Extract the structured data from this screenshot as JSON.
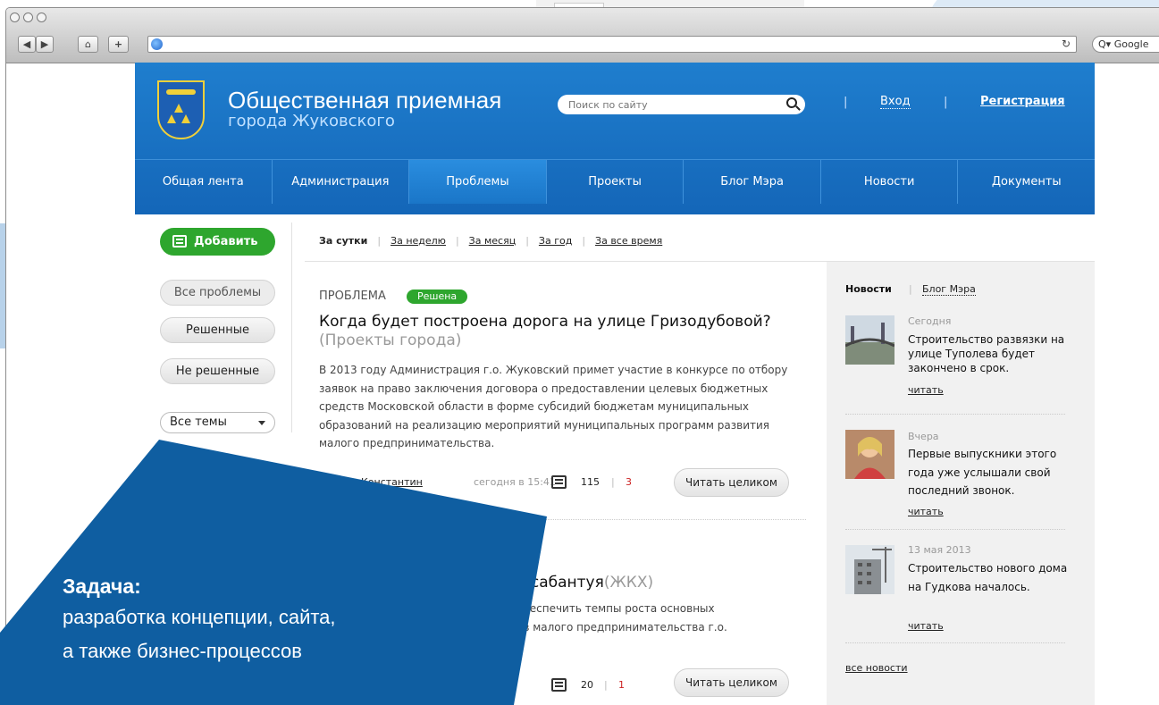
{
  "browser": {
    "search_placeholder": "Google"
  },
  "header": {
    "title": "Общественная приемная",
    "subtitle": "города Жуковского",
    "search_placeholder": "Поиск по сайту",
    "separator": "|",
    "login": "Вход",
    "register": "Регистрация"
  },
  "nav": [
    "Общая лента",
    "Администрация",
    "Проблемы",
    "Проекты",
    "Блог Мэра",
    "Новости",
    "Документы"
  ],
  "sidebar": {
    "add": "Добавить",
    "filters": [
      "Все проблемы",
      "Решенные",
      "Не решенные"
    ],
    "topics": "Все темы"
  },
  "tabs": [
    "За сутки",
    "За неделю",
    "За месяц",
    "За год",
    "За все время"
  ],
  "article1": {
    "kind": "ПРОБЛЕМА",
    "status": "Решена",
    "title": "Когда будет построена дорога на улице Гризодубовой?",
    "category": "(Проекты города)",
    "text": "В 2013 году Администрация г.о. Жуковский примет участие в конкурсе по отбору заявок на право заключения договора о предоставлении целевых бюджетных средств Московской области в форме субсидий бюджетам муниципальных образований на реализацию мероприятий муниципальных программ развития малого предпринимательства.",
    "author": "Константин",
    "time": "сегодня в 15:41",
    "comments": "115",
    "new_comments": "3",
    "read": "Читать целиком"
  },
  "article2": {
    "title_visible": "е сабантуя",
    "category": "(ЖКХ)",
    "text_line1": "обеспечить темпы роста основных",
    "text_line2": "ов малого предпринимательства г.о.",
    "comments": "20",
    "new_comments": "1",
    "read": "Читать целиком"
  },
  "news": {
    "tab_news": "Новости",
    "tab_blog": "Блог Мэра",
    "items": [
      {
        "date": "Сегодня",
        "text": "Строительство развязки на улице Туполева будет закончено в срок.",
        "read": "читать"
      },
      {
        "date": "Вчера",
        "text": "Первые выпускники этого года уже услышали свой последний звонок.",
        "read": "читать"
      },
      {
        "date": "13 мая 2013",
        "text": "Строительство нового дома на Гудкова началось.",
        "read": "читать"
      }
    ],
    "all": "все новости"
  },
  "banner": {
    "heading": "Задача:",
    "line1": "разработка концепции, сайта,",
    "line2": "а также бизнес-процессов"
  },
  "colors": {
    "header_blue": "#1870c2",
    "green": "#2ea62e",
    "banner_blue": "#0f5ea1",
    "red_count": "#cc2222"
  }
}
